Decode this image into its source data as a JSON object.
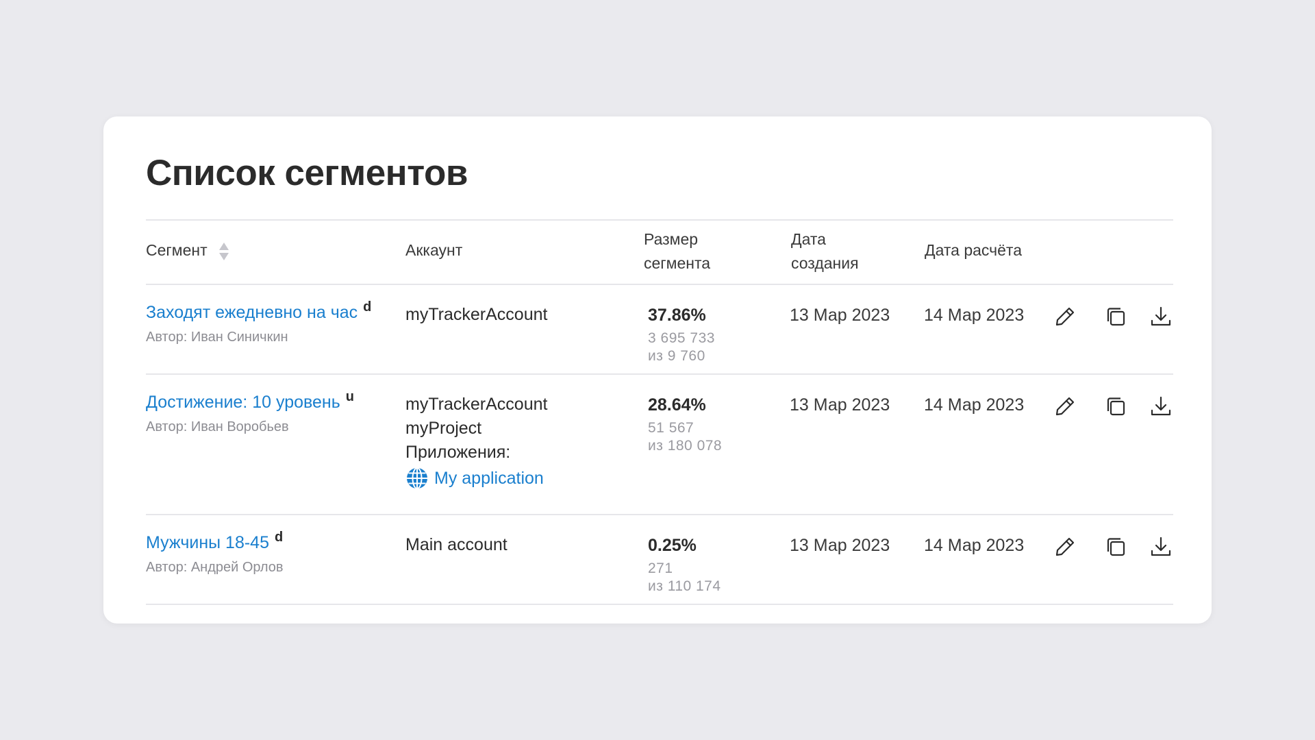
{
  "page": {
    "title": "Список сегментов"
  },
  "table": {
    "headers": {
      "segment": "Сегмент",
      "account": "Аккаунт",
      "size_line1": "Размер",
      "size_line2": "сегмента",
      "created_line1": "Дата",
      "created_line2": "создания",
      "calc": "Дата расчёта"
    },
    "rows": [
      {
        "name": "Заходят ежедневно на час",
        "tag": "d",
        "author": "Автор: Иван Синичкин",
        "account": [
          "myTrackerAccount"
        ],
        "pct": "37.86%",
        "count": "3 695 733",
        "total": "из 9 760",
        "created": "13 Мар 2023",
        "calculated": "14 Мар 2023"
      },
      {
        "name": "Достижение: 10 уровень",
        "tag": "u",
        "author": "Автор: Иван Воробьев",
        "account": [
          "myTrackerAccount",
          "myProject",
          "Приложения:"
        ],
        "app": "My application",
        "pct": "28.64%",
        "count": "51 567",
        "total": "из 180 078",
        "created": "13 Мар 2023",
        "calculated": "14 Мар 2023"
      },
      {
        "name": "Мужчины 18-45",
        "tag": "d",
        "author": "Автор: Андрей Орлов",
        "account": [
          "Main account"
        ],
        "pct": "0.25%",
        "count": "271",
        "total": "из 110 174",
        "created": "13 Мар 2023",
        "calculated": "14 Мар 2023"
      }
    ]
  },
  "icons": {
    "sort": "sort-icon",
    "edit": "pencil-icon",
    "copy": "copy-icon",
    "download": "download-icon",
    "app": "globe-icon"
  },
  "colors": {
    "link": "#1a7fce",
    "background": "#eaeaee",
    "card": "#ffffff"
  }
}
